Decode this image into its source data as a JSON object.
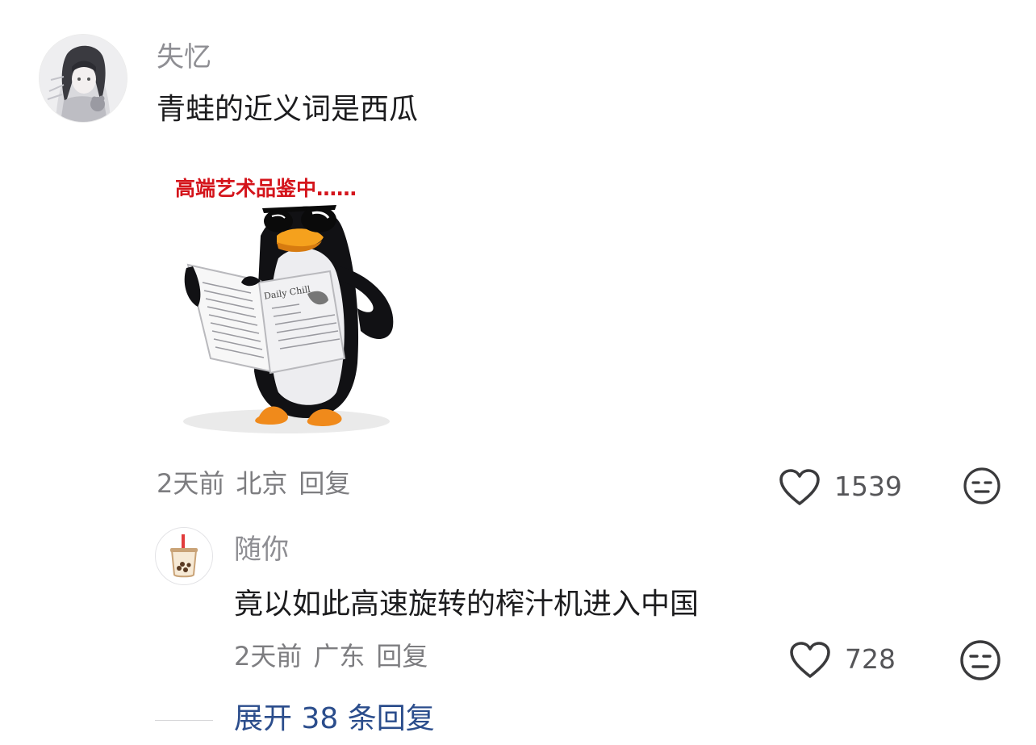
{
  "comment": {
    "username": "失忆",
    "text": "青蛙的近义词是西瓜",
    "sticker": {
      "caption": "高端艺术品鉴中……",
      "newspaper_title": "Daily Chill"
    },
    "meta": {
      "time": "2天前",
      "location": "北京",
      "reply_label": "回复"
    },
    "like_count": "1539",
    "icons": [
      "avatar-anime-girl",
      "heart-icon",
      "dislike-face-icon"
    ],
    "reply": {
      "username": "随你",
      "text": "竟以如此高速旋转的榨汁机进入中国",
      "meta": {
        "time": "2天前",
        "location": "广东",
        "reply_label": "回复"
      },
      "like_count": "728",
      "icons": [
        "bubble-tea-icon",
        "heart-icon",
        "dislike-face-icon"
      ]
    },
    "expand_label": "展开 38 条回复"
  },
  "colors": {
    "username": "#8e8e93",
    "text": "#1c1c1e",
    "meta": "#7d7d80",
    "expand_link": "#2b4d8c",
    "sticker_caption": "#d4141b"
  }
}
